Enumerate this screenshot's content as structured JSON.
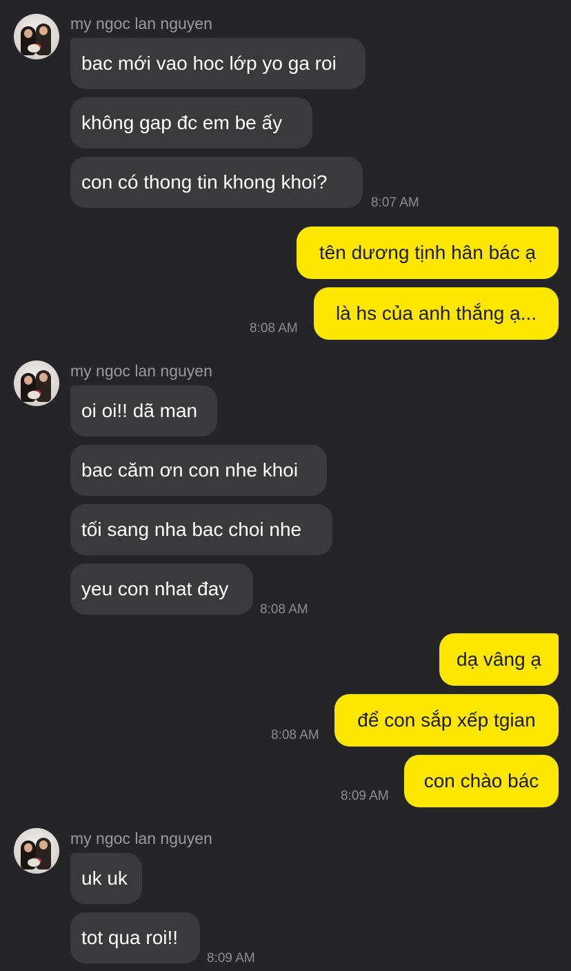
{
  "groups": [
    {
      "sender": "my ngoc lan nguyen",
      "messages": [
        "bac mới vao hoc lớp yo ga roi",
        "không gap đc em be ấy",
        "con có thong tin khong khoi?"
      ],
      "time": "8:07 AM"
    },
    {
      "messages": [
        "tên dương tịnh hân bác ạ",
        "là hs của anh thắng ạ..."
      ],
      "time": "8:08 AM"
    },
    {
      "sender": "my ngoc lan nguyen",
      "messages": [
        "oi oi!! dã man",
        "bac căm ơn con nhe khoi",
        "tối sang nha bac choi nhe",
        "yeu con nhat đay"
      ],
      "time": "8:08 AM"
    },
    {
      "messages": [
        "dạ vâng ạ",
        "để con sắp xếp tgian"
      ],
      "time": "8:08 AM"
    },
    {
      "messages": [
        "con chào bác"
      ],
      "time": "8:09 AM"
    },
    {
      "sender": "my ngoc lan nguyen",
      "messages": [
        "uk uk",
        "tot qua roi!!"
      ],
      "time": "8:09 AM"
    }
  ],
  "colors": {
    "background": "#252527",
    "incoming_bubble": "#3a3a3c",
    "outgoing_bubble": "#fde600"
  },
  "icons": {
    "avatar": "profile-photo"
  }
}
